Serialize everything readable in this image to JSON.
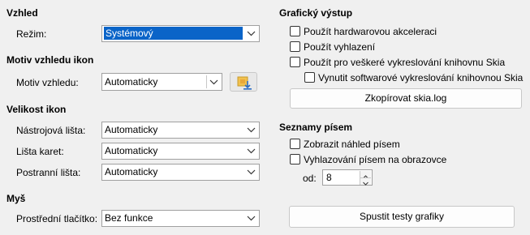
{
  "left": {
    "vzhled": {
      "title": "Vzhled",
      "mode_label": "Režim:",
      "mode_value": "Systémový"
    },
    "icon_theme": {
      "title": "Motiv vzhledu ikon",
      "label": "Motiv vzhledu:",
      "value": "Automaticky"
    },
    "icon_size": {
      "title": "Velikost ikon",
      "toolbar_label": "Nástrojová lišta:",
      "toolbar_value": "Automaticky",
      "tabbar_label": "Lišta karet:",
      "tabbar_value": "Automaticky",
      "sidebar_label": "Postranní lišta:",
      "sidebar_value": "Automaticky"
    },
    "mouse": {
      "title": "Myš",
      "middle_label": "Prostřední tlačítko:",
      "middle_value": "Bez funkce"
    }
  },
  "right": {
    "graphics": {
      "title": "Grafický výstup",
      "hw_accel": "Použít hardwarovou akceleraci",
      "antialias": "Použít vyhlazení",
      "skia_all": "Použít pro veškeré vykreslování knihovnu Skia",
      "skia_sw": "Vynutit softwarové vykreslování knihovnou Skia",
      "copy_log_button": "Zkopírovat skia.log"
    },
    "font_lists": {
      "title": "Seznamy písem",
      "preview": "Zobrazit náhled písem",
      "screen_aa": "Vyhlazování písem na obrazovce",
      "from_label": "od:",
      "from_value": "8",
      "run_tests_button": "Spustit testy grafiky"
    }
  }
}
